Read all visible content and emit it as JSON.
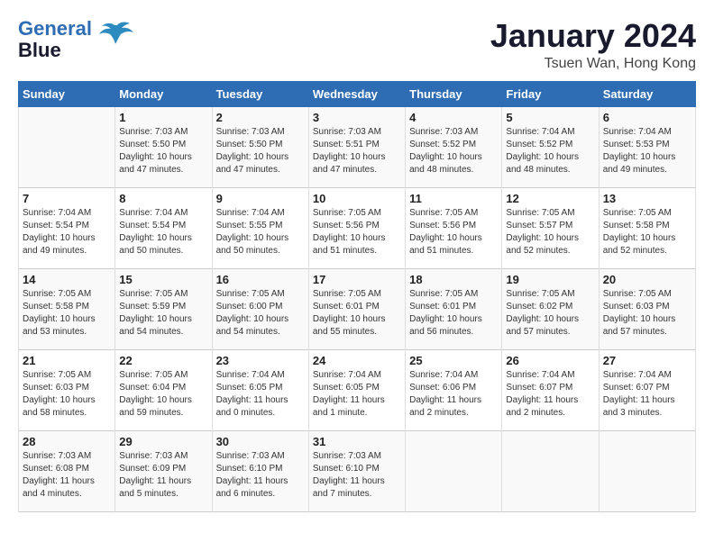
{
  "header": {
    "logo_line1": "General",
    "logo_line2": "Blue",
    "month_title": "January 2024",
    "subtitle": "Tsuen Wan, Hong Kong"
  },
  "days_of_week": [
    "Sunday",
    "Monday",
    "Tuesday",
    "Wednesday",
    "Thursday",
    "Friday",
    "Saturday"
  ],
  "weeks": [
    [
      {
        "day": "",
        "info": ""
      },
      {
        "day": "1",
        "info": "Sunrise: 7:03 AM\nSunset: 5:50 PM\nDaylight: 10 hours\nand 47 minutes."
      },
      {
        "day": "2",
        "info": "Sunrise: 7:03 AM\nSunset: 5:50 PM\nDaylight: 10 hours\nand 47 minutes."
      },
      {
        "day": "3",
        "info": "Sunrise: 7:03 AM\nSunset: 5:51 PM\nDaylight: 10 hours\nand 47 minutes."
      },
      {
        "day": "4",
        "info": "Sunrise: 7:03 AM\nSunset: 5:52 PM\nDaylight: 10 hours\nand 48 minutes."
      },
      {
        "day": "5",
        "info": "Sunrise: 7:04 AM\nSunset: 5:52 PM\nDaylight: 10 hours\nand 48 minutes."
      },
      {
        "day": "6",
        "info": "Sunrise: 7:04 AM\nSunset: 5:53 PM\nDaylight: 10 hours\nand 49 minutes."
      }
    ],
    [
      {
        "day": "7",
        "info": "Sunrise: 7:04 AM\nSunset: 5:54 PM\nDaylight: 10 hours\nand 49 minutes."
      },
      {
        "day": "8",
        "info": "Sunrise: 7:04 AM\nSunset: 5:54 PM\nDaylight: 10 hours\nand 50 minutes."
      },
      {
        "day": "9",
        "info": "Sunrise: 7:04 AM\nSunset: 5:55 PM\nDaylight: 10 hours\nand 50 minutes."
      },
      {
        "day": "10",
        "info": "Sunrise: 7:05 AM\nSunset: 5:56 PM\nDaylight: 10 hours\nand 51 minutes."
      },
      {
        "day": "11",
        "info": "Sunrise: 7:05 AM\nSunset: 5:56 PM\nDaylight: 10 hours\nand 51 minutes."
      },
      {
        "day": "12",
        "info": "Sunrise: 7:05 AM\nSunset: 5:57 PM\nDaylight: 10 hours\nand 52 minutes."
      },
      {
        "day": "13",
        "info": "Sunrise: 7:05 AM\nSunset: 5:58 PM\nDaylight: 10 hours\nand 52 minutes."
      }
    ],
    [
      {
        "day": "14",
        "info": "Sunrise: 7:05 AM\nSunset: 5:58 PM\nDaylight: 10 hours\nand 53 minutes."
      },
      {
        "day": "15",
        "info": "Sunrise: 7:05 AM\nSunset: 5:59 PM\nDaylight: 10 hours\nand 54 minutes."
      },
      {
        "day": "16",
        "info": "Sunrise: 7:05 AM\nSunset: 6:00 PM\nDaylight: 10 hours\nand 54 minutes."
      },
      {
        "day": "17",
        "info": "Sunrise: 7:05 AM\nSunset: 6:01 PM\nDaylight: 10 hours\nand 55 minutes."
      },
      {
        "day": "18",
        "info": "Sunrise: 7:05 AM\nSunset: 6:01 PM\nDaylight: 10 hours\nand 56 minutes."
      },
      {
        "day": "19",
        "info": "Sunrise: 7:05 AM\nSunset: 6:02 PM\nDaylight: 10 hours\nand 57 minutes."
      },
      {
        "day": "20",
        "info": "Sunrise: 7:05 AM\nSunset: 6:03 PM\nDaylight: 10 hours\nand 57 minutes."
      }
    ],
    [
      {
        "day": "21",
        "info": "Sunrise: 7:05 AM\nSunset: 6:03 PM\nDaylight: 10 hours\nand 58 minutes."
      },
      {
        "day": "22",
        "info": "Sunrise: 7:05 AM\nSunset: 6:04 PM\nDaylight: 10 hours\nand 59 minutes."
      },
      {
        "day": "23",
        "info": "Sunrise: 7:04 AM\nSunset: 6:05 PM\nDaylight: 11 hours\nand 0 minutes."
      },
      {
        "day": "24",
        "info": "Sunrise: 7:04 AM\nSunset: 6:05 PM\nDaylight: 11 hours\nand 1 minute."
      },
      {
        "day": "25",
        "info": "Sunrise: 7:04 AM\nSunset: 6:06 PM\nDaylight: 11 hours\nand 2 minutes."
      },
      {
        "day": "26",
        "info": "Sunrise: 7:04 AM\nSunset: 6:07 PM\nDaylight: 11 hours\nand 2 minutes."
      },
      {
        "day": "27",
        "info": "Sunrise: 7:04 AM\nSunset: 6:07 PM\nDaylight: 11 hours\nand 3 minutes."
      }
    ],
    [
      {
        "day": "28",
        "info": "Sunrise: 7:03 AM\nSunset: 6:08 PM\nDaylight: 11 hours\nand 4 minutes."
      },
      {
        "day": "29",
        "info": "Sunrise: 7:03 AM\nSunset: 6:09 PM\nDaylight: 11 hours\nand 5 minutes."
      },
      {
        "day": "30",
        "info": "Sunrise: 7:03 AM\nSunset: 6:10 PM\nDaylight: 11 hours\nand 6 minutes."
      },
      {
        "day": "31",
        "info": "Sunrise: 7:03 AM\nSunset: 6:10 PM\nDaylight: 11 hours\nand 7 minutes."
      },
      {
        "day": "",
        "info": ""
      },
      {
        "day": "",
        "info": ""
      },
      {
        "day": "",
        "info": ""
      }
    ]
  ]
}
